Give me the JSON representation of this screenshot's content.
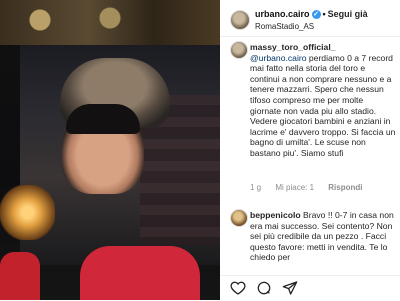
{
  "header": {
    "username": "urbano.cairo",
    "verified_mark": "✓",
    "separator": "•",
    "follow_label": "Segui già",
    "location": "RomaStadio_AS"
  },
  "comments": [
    {
      "username": "massy_toro_official_",
      "mention": "@urbano.cairo",
      "text": " perdiamo 0 a 7 record mai fatto nella storia del toro e continui a non comprare nessuno e a tenere mazzarri. Spero che nessun tifoso compreso me per molte giornate non vada piu allo stadio. Vedere giocatori bambini e anziani in lacrime e' davvero troppo. Si faccia un bagno di umilta'. Le scuse non bastano piu'. Siamo stufi",
      "time": "1 g",
      "likes": "Mi piace: 1",
      "reply": "Rispondi"
    },
    {
      "username": "beppenicolo",
      "text": " Bravo !! 0-7 in casa non era mai successo. Sei contento? Non sei più credibile da un pezzo . Facci questo favore: metti in vendita. Te lo chiedo per"
    }
  ],
  "actions": {
    "like_icon": "heart-icon",
    "comment_icon": "comment-icon",
    "share_icon": "share-icon"
  },
  "colors": {
    "verified": "#3897f0",
    "text": "#262626",
    "meta": "#8e8e8e"
  }
}
